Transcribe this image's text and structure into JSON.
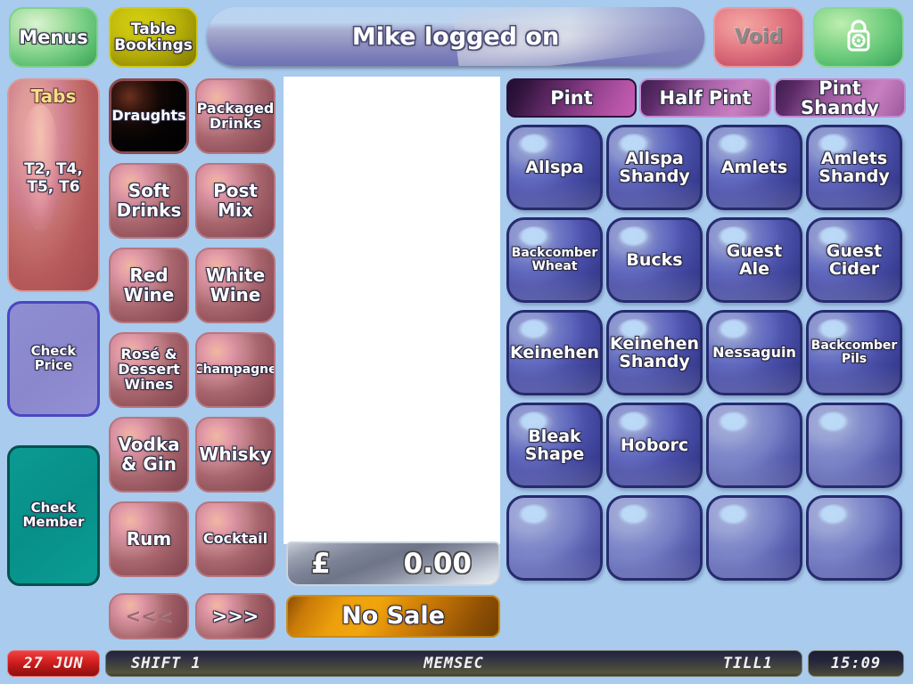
{
  "header": {
    "menus_label": "Menus",
    "table_bookings_label": "Table Bookings",
    "title": "Mike logged on",
    "void_label": "Void",
    "lock_icon": "padlock-icon"
  },
  "sidebar": {
    "tabs": {
      "title": "Tabs",
      "list": "T2, T4, T5, T6"
    },
    "check_price_label": "Check Price",
    "check_member_label": "Check Member"
  },
  "categories": [
    {
      "label": "Draughts",
      "selected": true,
      "size": "small"
    },
    {
      "label": "Packaged Drinks",
      "selected": false,
      "size": "small"
    },
    {
      "label": "Soft Drinks",
      "selected": false,
      "size": "normal"
    },
    {
      "label": "Post Mix",
      "selected": false,
      "size": "normal"
    },
    {
      "label": "Red Wine",
      "selected": false,
      "size": "normal"
    },
    {
      "label": "White Wine",
      "selected": false,
      "size": "normal"
    },
    {
      "label": "Rosé & Dessert Wines",
      "selected": false,
      "size": "small"
    },
    {
      "label": "Champagne",
      "selected": false,
      "size": "xsmall"
    },
    {
      "label": "Vodka & Gin",
      "selected": false,
      "size": "normal"
    },
    {
      "label": "Whisky",
      "selected": false,
      "size": "normal"
    },
    {
      "label": "Rum",
      "selected": false,
      "size": "normal"
    },
    {
      "label": "Cocktail",
      "selected": false,
      "size": "small"
    }
  ],
  "nav": {
    "prev_label": "<<<",
    "next_label": ">>>"
  },
  "receipt": {
    "lines": []
  },
  "total": {
    "currency": "£",
    "value": "0.00"
  },
  "no_sale_label": "No Sale",
  "size_tabs": [
    {
      "label": "Pint",
      "selected": true
    },
    {
      "label": "Half Pint",
      "selected": false
    },
    {
      "label": "Pint Shandy",
      "selected": false
    }
  ],
  "products": [
    {
      "label": "Allspa",
      "size": "normal"
    },
    {
      "label": "Allspa Shandy",
      "size": "normal"
    },
    {
      "label": "Amlets",
      "size": "normal"
    },
    {
      "label": "Amlets Shandy",
      "size": "normal"
    },
    {
      "label": "Backcomber Wheat",
      "size": "xsmall"
    },
    {
      "label": "Bucks",
      "size": "normal"
    },
    {
      "label": "Guest Ale",
      "size": "normal"
    },
    {
      "label": "Guest Cider",
      "size": "normal"
    },
    {
      "label": "Keinehen",
      "size": "normal"
    },
    {
      "label": "Keinehen Shandy",
      "size": "normal"
    },
    {
      "label": "Nessaguin",
      "size": "small"
    },
    {
      "label": "Backcomber Pils",
      "size": "xsmall"
    },
    {
      "label": "Bleak Shape",
      "size": "normal"
    },
    {
      "label": "Hoborc",
      "size": "normal"
    },
    {
      "label": "",
      "size": "normal"
    },
    {
      "label": "",
      "size": "normal"
    },
    {
      "label": "",
      "size": "normal"
    },
    {
      "label": "",
      "size": "normal"
    },
    {
      "label": "",
      "size": "normal"
    },
    {
      "label": "",
      "size": "normal"
    }
  ],
  "status_bar": {
    "date": "27 JUN",
    "shift": "SHIFT 1",
    "operator": "MEMSEC",
    "till": "TILL1",
    "time": "15:09"
  },
  "colors": {
    "background": "#a8cbee",
    "category": "#a9666e",
    "category_selected": "#000000",
    "product": "#4a4fa8",
    "tab_selected": "#6d2f70",
    "no_sale": "#eda00c",
    "void": "#e0737f",
    "green": "#6ccb7c",
    "check_member": "#079089",
    "check_price": "#8a87cd",
    "status_date": "#d52020"
  }
}
